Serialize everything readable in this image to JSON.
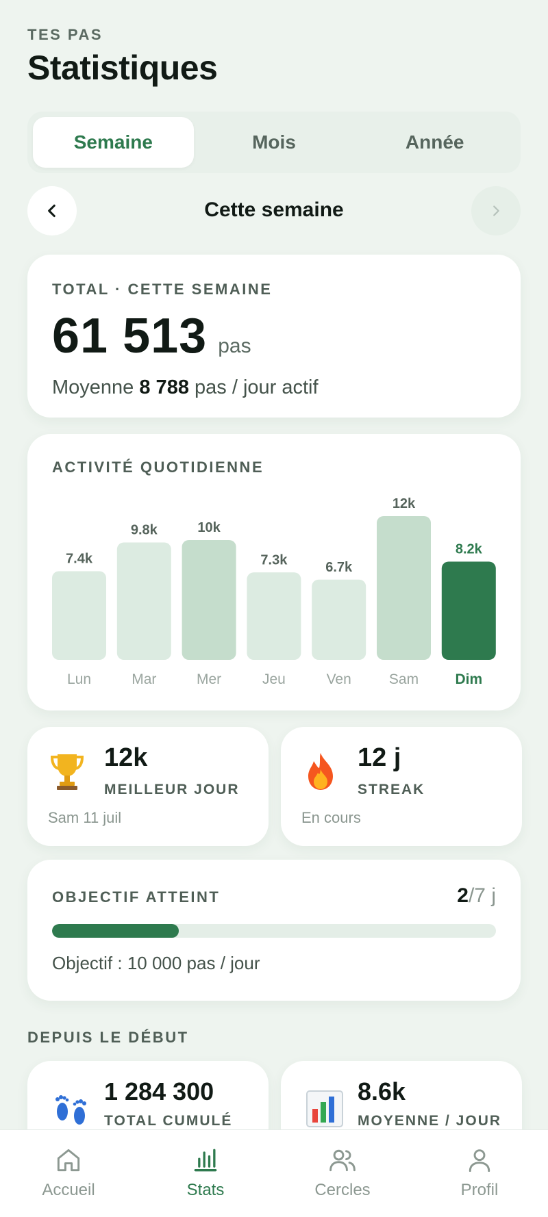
{
  "header": {
    "eyebrow": "TES PAS",
    "title": "Statistiques"
  },
  "tabs": [
    {
      "label": "Semaine",
      "active": true
    },
    {
      "label": "Mois",
      "active": false
    },
    {
      "label": "Année",
      "active": false
    }
  ],
  "period": {
    "label": "Cette semaine"
  },
  "total": {
    "label": "TOTAL · CETTE SEMAINE",
    "value": "61 513",
    "unit": "pas",
    "avg_prefix": "Moyenne",
    "avg_value": "8 788",
    "avg_suffix": "pas / jour actif"
  },
  "chart": {
    "label": "ACTIVITÉ QUOTIDIENNE"
  },
  "chart_data": {
    "type": "bar",
    "categories": [
      "Lun",
      "Mar",
      "Mer",
      "Jeu",
      "Ven",
      "Sam",
      "Dim"
    ],
    "values": [
      7400,
      9800,
      10000,
      7300,
      6700,
      12000,
      8200
    ],
    "data_labels": [
      "7.4k",
      "9.8k",
      "10k",
      "7.3k",
      "6.7k",
      "12k",
      "8.2k"
    ],
    "highlight_index": 6,
    "title": "ACTIVITÉ QUOTIDIENNE",
    "ylim": [
      0,
      12000
    ],
    "colors": {
      "low": "#dcebe1",
      "high": "#c5ddcc",
      "current": "#2e7a4e"
    },
    "threshold": 10000
  },
  "best_day": {
    "value": "12k",
    "label": "MEILLEUR JOUR",
    "sub": "Sam 11 juil",
    "icon": "trophy-icon"
  },
  "streak": {
    "value": "12 j",
    "label": "STREAK",
    "sub": "En cours",
    "icon": "fire-icon"
  },
  "goal": {
    "label": "OBJECTIF ATTEINT",
    "achieved": "2",
    "total_suffix": "/7 j",
    "progress": 0.2857,
    "sub": "Objectif : 10 000 pas / jour"
  },
  "since": {
    "title": "DEPUIS LE DÉBUT",
    "total": {
      "value": "1 284 300",
      "label": "TOTAL CUMULÉ",
      "icon": "footprints-icon"
    },
    "average": {
      "value": "8.6k",
      "label": "MOYENNE / JOUR",
      "icon": "bar-chart-icon"
    }
  },
  "bottom_nav": [
    {
      "label": "Accueil",
      "icon": "home-icon",
      "active": false
    },
    {
      "label": "Stats",
      "icon": "stats-icon",
      "active": true
    },
    {
      "label": "Cercles",
      "icon": "users-icon",
      "active": false
    },
    {
      "label": "Profil",
      "icon": "user-icon",
      "active": false
    }
  ],
  "colors": {
    "accent": "#2e7a4e",
    "background": "#eef4ef"
  }
}
